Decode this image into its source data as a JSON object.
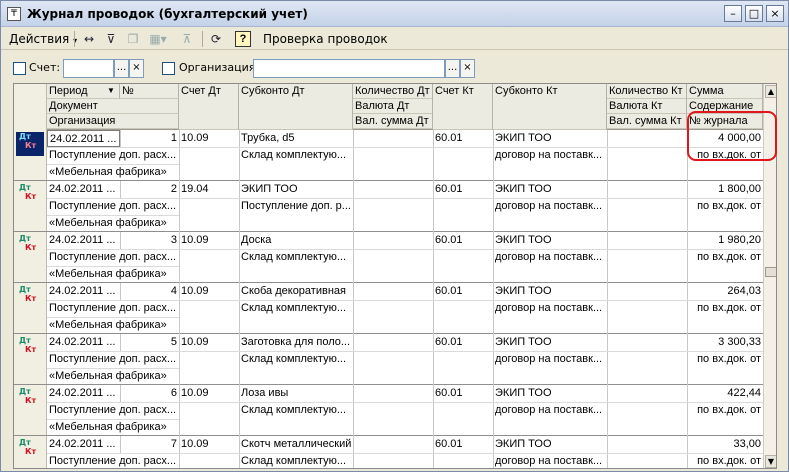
{
  "window": {
    "title": "Журнал проводок (бухгалтерский учет)",
    "icon": "journal-app-icon",
    "controls": [
      "minimize",
      "maximize",
      "close"
    ]
  },
  "toolbar": {
    "actions_label": "Действия",
    "check_label": "Проверка проводок",
    "icons": [
      "refresh-sync-icon",
      "filter-icon",
      "copy-icon",
      "clear-filter-icon",
      "reload-icon",
      "help-icon"
    ]
  },
  "filter": {
    "account_label": "Счет:",
    "account_value": "",
    "org_label": "Организация:",
    "org_value": "",
    "select_glyph": "...",
    "clear_glyph": "×"
  },
  "table": {
    "headers": {
      "period": "Период",
      "num": "№",
      "document": "Документ",
      "organization": "Организация",
      "debit_account": "Счет Дт",
      "debit_subconto": "Субконто Дт",
      "debit_qty": "Количество Дт",
      "debit_currency": "Валюта Дт",
      "debit_cur_sum": "Вал. сумма Дт",
      "credit_account": "Счет Кт",
      "credit_subconto": "Субконто Кт",
      "credit_qty": "Количество Кт",
      "credit_currency": "Валюта Кт",
      "credit_cur_sum": "Вал. сумма Кт",
      "amount": "Сумма",
      "content": "Содержание",
      "journal_no": "№ журнала"
    },
    "badge": {
      "dt": "Дт",
      "kt": "Кт"
    },
    "rows": [
      {
        "period": "24.02.2011 ...",
        "num": "1",
        "document": "Поступление доп. расх...",
        "organization": "«Мебельная фабрика»",
        "debit_account": "10.09",
        "debit_sub1": "Трубка, d5",
        "debit_sub2": "Склад комплектую...",
        "credit_account": "60.01",
        "credit_sub1": "ЭКИП ТОО",
        "credit_sub2": "договор на поставк...",
        "amount": "4 000,00",
        "content": "по вх.док.  от",
        "selected": true
      },
      {
        "period": "24.02.2011 ...",
        "num": "2",
        "document": "Поступление доп. расх...",
        "organization": "«Мебельная фабрика»",
        "debit_account": "19.04",
        "debit_sub1": "ЭКИП ТОО",
        "debit_sub2": "Поступление доп. р...",
        "credit_account": "60.01",
        "credit_sub1": "ЭКИП ТОО",
        "credit_sub2": "договор на поставк...",
        "amount": "1 800,00",
        "content": "по вх.док.  от",
        "selected": false
      },
      {
        "period": "24.02.2011 ...",
        "num": "3",
        "document": "Поступление доп. расх...",
        "organization": "«Мебельная фабрика»",
        "debit_account": "10.09",
        "debit_sub1": "Доска",
        "debit_sub2": "Склад комплектую...",
        "credit_account": "60.01",
        "credit_sub1": "ЭКИП ТОО",
        "credit_sub2": "договор на поставк...",
        "amount": "1 980,20",
        "content": "по вх.док.  от",
        "selected": false
      },
      {
        "period": "24.02.2011 ...",
        "num": "4",
        "document": "Поступление доп. расх...",
        "organization": "«Мебельная фабрика»",
        "debit_account": "10.09",
        "debit_sub1": "Скоба декоративная",
        "debit_sub2": "Склад комплектую...",
        "credit_account": "60.01",
        "credit_sub1": "ЭКИП ТОО",
        "credit_sub2": "договор на поставк...",
        "amount": "264,03",
        "content": "по вх.док.  от",
        "selected": false
      },
      {
        "period": "24.02.2011 ...",
        "num": "5",
        "document": "Поступление доп. расх...",
        "organization": "«Мебельная фабрика»",
        "debit_account": "10.09",
        "debit_sub1": "Заготовка для поло...",
        "debit_sub2": "Склад комплектую...",
        "credit_account": "60.01",
        "credit_sub1": "ЭКИП ТОО",
        "credit_sub2": "договор на поставк...",
        "amount": "3 300,33",
        "content": "по вх.док.  от",
        "selected": false
      },
      {
        "period": "24.02.2011 ...",
        "num": "6",
        "document": "Поступление доп. расх...",
        "organization": "«Мебельная фабрика»",
        "debit_account": "10.09",
        "debit_sub1": "Лоза ивы",
        "debit_sub2": "Склад комплектую...",
        "credit_account": "60.01",
        "credit_sub1": "ЭКИП ТОО",
        "credit_sub2": "договор на поставк...",
        "amount": "422,44",
        "content": "по вх.док.  от",
        "selected": false
      },
      {
        "period": "24.02.2011 ...",
        "num": "7",
        "document": "Поступление доп. расх...",
        "organization": "«Мебельная фабрика»",
        "debit_account": "10.09",
        "debit_sub1": "Скотч металлический",
        "debit_sub2": "Склад комплектую...",
        "credit_account": "60.01",
        "credit_sub1": "ЭКИП ТОО",
        "credit_sub2": "договор на поставк...",
        "amount": "33,00",
        "content": "по вх.док.  от",
        "selected": false
      }
    ]
  }
}
